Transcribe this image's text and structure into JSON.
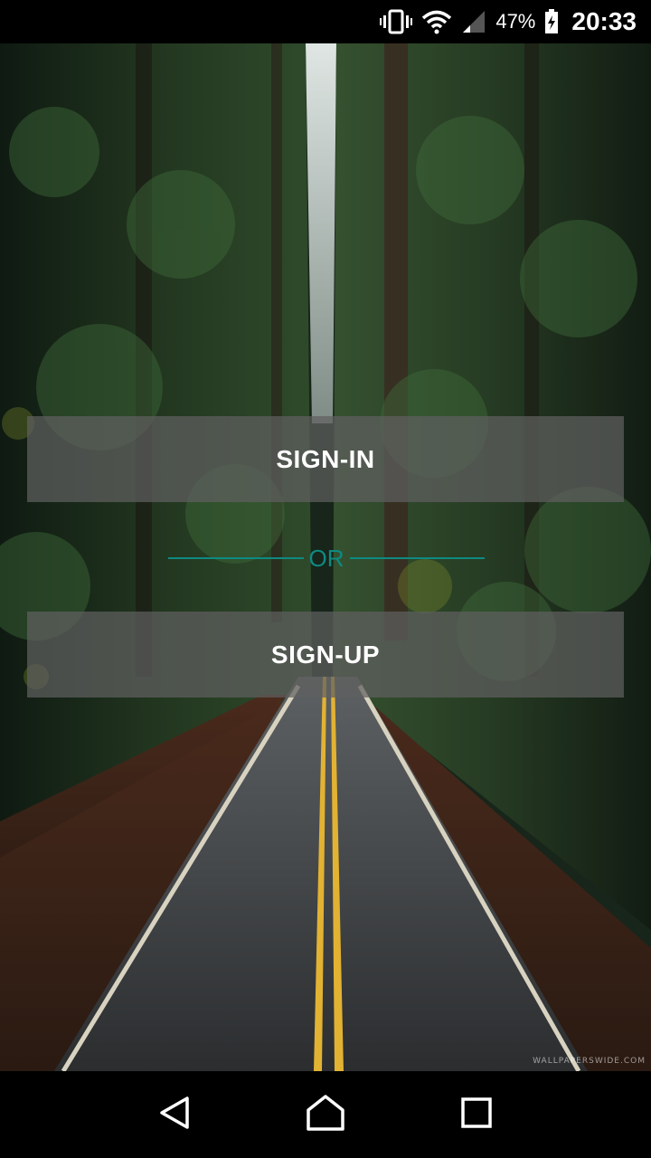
{
  "status_bar": {
    "battery_percent": "47%",
    "time": "20:33",
    "icons": [
      "vibrate-icon",
      "wifi-icon",
      "signal-icon",
      "battery-icon"
    ]
  },
  "auth": {
    "signin_label": "SIGN-IN",
    "or_label": "OR",
    "signup_label": "SIGN-UP"
  },
  "background": {
    "watermark": "WALLPAPERSWIDE.COM"
  },
  "nav_bar": {
    "icons": [
      "back-icon",
      "home-icon",
      "recents-icon"
    ]
  },
  "colors": {
    "accent": "#0e8a82",
    "button_bg": "#5f5f5f"
  }
}
